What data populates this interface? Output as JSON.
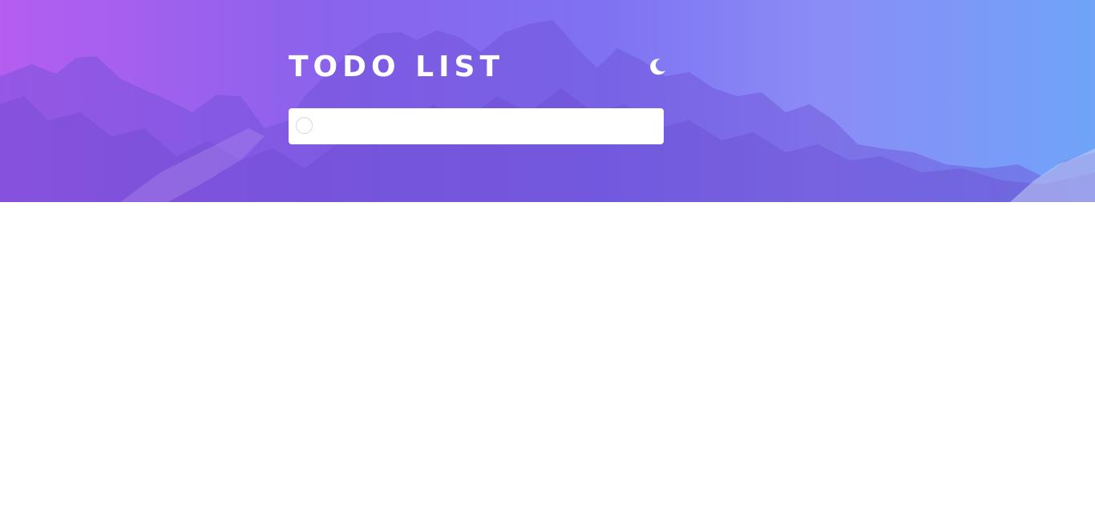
{
  "header": {
    "title": "TODO LIST",
    "theme_toggle_icon": "moon-icon"
  },
  "new_todo": {
    "value": "",
    "placeholder": "",
    "check_icon": "circle-check-icon"
  },
  "colors": {
    "gradient_start": "#b55ef0",
    "gradient_end": "#6fa4f8",
    "input_background": "#ffffff",
    "page_background": "#ffffff"
  }
}
